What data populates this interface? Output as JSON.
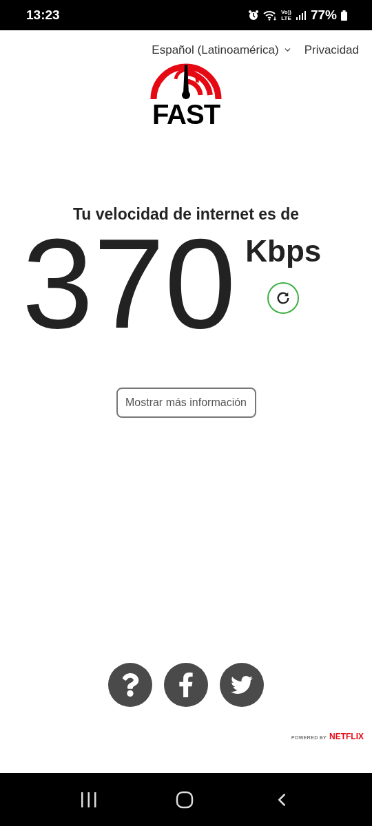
{
  "status_bar": {
    "time": "13:23",
    "volte": [
      "Vo))",
      "LTE"
    ],
    "battery_text": "77%"
  },
  "header": {
    "language": "Español (Latinoamérica)",
    "privacy": "Privacidad"
  },
  "logo": {
    "text": "FAST"
  },
  "result": {
    "heading": "Tu velocidad de internet es de",
    "value": "370",
    "unit": "Kbps"
  },
  "more_info_button": "Mostrar más información",
  "social": [
    {
      "kind": "help"
    },
    {
      "kind": "facebook"
    },
    {
      "kind": "twitter"
    }
  ],
  "footer": {
    "powered_by": "POWERED BY",
    "brand": "NETFLIX"
  }
}
